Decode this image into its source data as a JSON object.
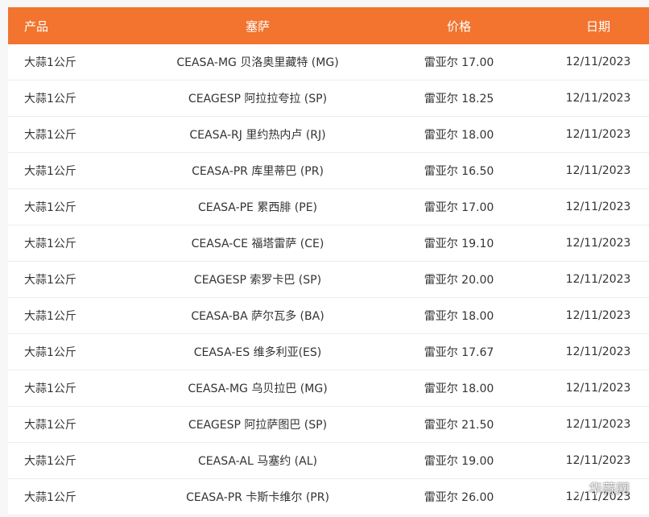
{
  "table": {
    "headers": [
      "产品",
      "塞萨",
      "价格",
      "日期"
    ],
    "rows": [
      {
        "product": "大蒜1公斤",
        "market": "CEASA-MG 贝洛奥里藏特 (MG)",
        "price": "雷亚尔 17.00",
        "date": "12/11/2023"
      },
      {
        "product": "大蒜1公斤",
        "market": "CEAGESP 阿拉拉夸拉 (SP)",
        "price": "雷亚尔 18.25",
        "date": "12/11/2023"
      },
      {
        "product": "大蒜1公斤",
        "market": "CEASA-RJ 里约热内卢 (RJ)",
        "price": "雷亚尔 18.00",
        "date": "12/11/2023"
      },
      {
        "product": "大蒜1公斤",
        "market": "CEASA-PR 库里蒂巴 (PR)",
        "price": "雷亚尔 16.50",
        "date": "12/11/2023"
      },
      {
        "product": "大蒜1公斤",
        "market": "CEASA-PE 累西腓 (PE)",
        "price": "雷亚尔 17.00",
        "date": "12/11/2023"
      },
      {
        "product": "大蒜1公斤",
        "market": "CEASA-CE 福塔雷萨 (CE)",
        "price": "雷亚尔 19.10",
        "date": "12/11/2023"
      },
      {
        "product": "大蒜1公斤",
        "market": "CEAGESP 索罗卡巴 (SP)",
        "price": "雷亚尔 20.00",
        "date": "12/11/2023"
      },
      {
        "product": "大蒜1公斤",
        "market": "CEASA-BA 萨尔瓦多 (BA)",
        "price": "雷亚尔 18.00",
        "date": "12/11/2023"
      },
      {
        "product": "大蒜1公斤",
        "market": "CEASA-ES 维多利亚(ES)",
        "price": "雷亚尔 17.67",
        "date": "12/11/2023"
      },
      {
        "product": "大蒜1公斤",
        "market": "CEASA-MG 乌贝拉巴 (MG)",
        "price": "雷亚尔 18.00",
        "date": "12/11/2023"
      },
      {
        "product": "大蒜1公斤",
        "market": "CEAGESP 阿拉萨图巴 (SP)",
        "price": "雷亚尔 21.50",
        "date": "12/11/2023"
      },
      {
        "product": "大蒜1公斤",
        "market": "CEASA-AL 马塞约 (AL)",
        "price": "雷亚尔 19.00",
        "date": "12/11/2023"
      },
      {
        "product": "大蒜1公斤",
        "market": "CEASA-PR 卡斯卡维尔 (PR)",
        "price": "雷亚尔 26.00",
        "date": "12/11/2023"
      }
    ]
  },
  "watermark": {
    "text": "华蒜网",
    "icon": "wechat-icon"
  },
  "colors": {
    "header_bg": "#f2742f",
    "header_text": "#ffffff",
    "row_border": "#ececec",
    "cell_text": "#333333"
  }
}
